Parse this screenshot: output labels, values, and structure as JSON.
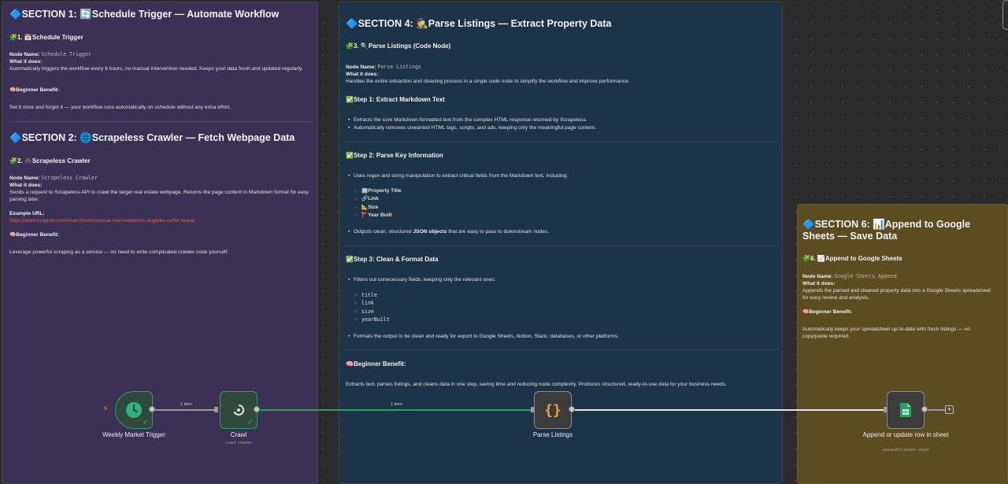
{
  "section1": {
    "title": "🔷SECTION 1: 🔄Schedule Trigger — Automate Workflow",
    "heading": "🧩1. 📅Schedule Trigger",
    "node_name_label": "Node Name:",
    "node_name": "Schedule Trigger",
    "what_label": "What it does:",
    "what_text": "Automatically triggers the workflow every 6 hours, no manual intervention needed. Keeps your data fresh and updated regularly.",
    "benefit_label": "🧠Beginner Benefit:",
    "benefit_text": "Set it once and forget it — your workflow runs automatically on schedule without any extra effort."
  },
  "section2": {
    "title": "🔷SECTION 2: 🌐Scrapeless Crawler — Fetch Webpage Data",
    "heading": "🧩2. 🕷️Scrapeless Crawler",
    "node_name_label": "Node Name:",
    "node_name": "Scrapeless Crawler",
    "what_label": "What it does:",
    "what_text": "Sends a request to Scrapeless API to crawl the target real estate webpage. Returns the page content in Markdown format for easy parsing later.",
    "url_label": "Example URL:",
    "url": "https://www.loopnet.com/search/commercial-real-estate/los-angeles-ca/for-lease/",
    "benefit_label": "🧠Beginner Benefit:",
    "benefit_text": "Leverage powerful scraping as a service — no need to write complicated crawler code yourself."
  },
  "section4": {
    "title": "🔷SECTION 4: 🕵️Parse Listings — Extract Property Data",
    "heading": "🧩3. 🔍Parse Listings (Code Node)",
    "node_name_label": "Node Name:",
    "node_name": "Parse Listings",
    "what_label": "What it does:",
    "what_text": "Handles the entire extraction and cleaning process in a single code node to simplify the workflow and improve performance.",
    "step1_title": "✅Step 1: Extract Markdown Text",
    "step1_items": [
      "Extracts the core Markdown-formatted text from the complex HTML response returned by Scrapeless.",
      "Automatically removes unwanted HTML tags, scripts, and ads, keeping only the meaningful page content."
    ],
    "step2_title": "✅Step 2: Parse Key Information",
    "step2_intro": "Uses regex and string manipulation to extract critical fields from the Markdown text, including:",
    "step2_fields": [
      "🏢Property Title",
      "🔗Link",
      "📐Size",
      "🚩Year Built"
    ],
    "step2_outro_a": "Outputs clean, structured ",
    "step2_outro_b": "JSON objects",
    "step2_outro_c": " that are easy to pass to downstream nodes.",
    "step3_title": "✅Step 3: Clean & Format Data",
    "step3_intro": "Filters out unnecessary fields, keeping only the relevant ones:",
    "step3_fields": [
      "title",
      "link",
      "size",
      "yearBuilt"
    ],
    "step3_outro": "Formats the output to be clean and ready for export to Google Sheets, Notion, Slack, databases, or other platforms.",
    "benefit_label": "🧠Beginner Benefit:",
    "benefit_text": "Extracts text, parses listings, and cleans data in one step, saving time and reducing node complexity. Produces structured, ready-to-use data for your business needs."
  },
  "section6": {
    "title": "🔷SECTION 6: 📊Append to Google Sheets — Save Data",
    "heading": "🧩6. 📈Append to Google Sheets",
    "node_name_label": "Node Name:",
    "node_name": "Google Sheets Append",
    "what_label": "What it does:",
    "what_text": "Appends the parsed and cleaned property data into a Google Sheets spreadsheet for easy review and analysis.",
    "benefit_label": "🧠Beginner Benefit:",
    "benefit_text": "Automatically keeps your spreadsheet up-to-date with fresh listings — no copy/paste required."
  },
  "nodes": {
    "trigger": {
      "label": "Weekly Market Trigger",
      "icon": "clock-icon"
    },
    "crawl": {
      "label": "Crawl",
      "sub": "crawl: crawler",
      "icon": "scrapeless-icon"
    },
    "parse": {
      "label": "Parse Listings",
      "icon": "code-braces-icon",
      "glyph": "{}"
    },
    "sheets": {
      "label": "Append or update row in sheet",
      "sub": "appendOrUpdate: sheet",
      "icon": "google-sheets-icon"
    }
  },
  "connections": {
    "trigger_to_crawl": "1 item",
    "crawl_to_parse": "1 item"
  },
  "colors": {
    "canvas": "#2b2b2b",
    "note_purple": "#3b3154",
    "note_blue": "#1d3347",
    "note_gold": "#5c4d21",
    "success": "#2f9b6b",
    "link": "#e0605a"
  }
}
